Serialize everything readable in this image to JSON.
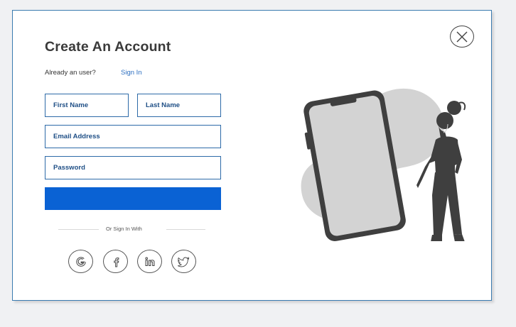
{
  "modal": {
    "title": "Create An Account",
    "already_user_text": "Already an user?",
    "signin_link": "Sign In"
  },
  "form": {
    "first_name": {
      "placeholder": "First Name",
      "value": ""
    },
    "last_name": {
      "placeholder": "Last Name",
      "value": ""
    },
    "email": {
      "placeholder": "Email Address",
      "value": ""
    },
    "password": {
      "placeholder": "Password",
      "value": ""
    },
    "submit_label": ""
  },
  "social": {
    "divider_text": "Or Sign In With",
    "providers": [
      "google-icon",
      "facebook-icon",
      "linkedin-icon",
      "twitter-icon"
    ]
  },
  "colors": {
    "accent": "#0a62d4",
    "link": "#2c6fc0",
    "field_border": "#2d6aa8",
    "field_text": "#1f4f86",
    "illustration_dark": "#3f3f3f",
    "illustration_light": "#d3d3d3"
  }
}
